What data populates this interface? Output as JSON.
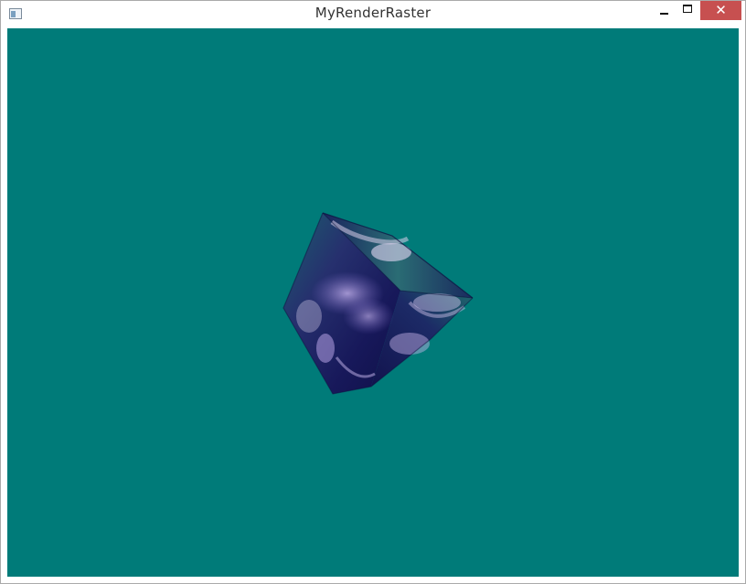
{
  "window": {
    "title": "MyRenderRaster",
    "icon": "app-window-icon",
    "controls": {
      "minimize_icon": "minimize-icon",
      "maximize_icon": "maximize-icon",
      "close_glyph": "✕"
    }
  },
  "viewport": {
    "background_color": "#007b79",
    "object": "textured-cube"
  }
}
